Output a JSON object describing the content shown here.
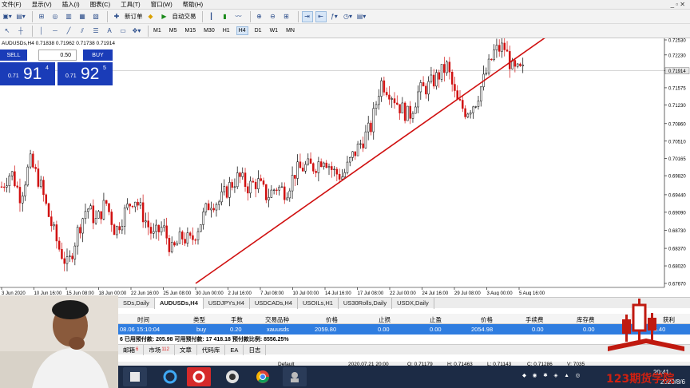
{
  "menu": {
    "items": [
      "文件(F)",
      "显示(V)",
      "插入(I)",
      "图表(C)",
      "工具(T)",
      "窗口(W)",
      "帮助(H)"
    ]
  },
  "toolbar1": {
    "new_order_label": "新订单",
    "autotrade_label": "自动交易"
  },
  "toolbar2": {
    "timeframes": [
      "M1",
      "M5",
      "M15",
      "M30",
      "H1",
      "H4",
      "D1",
      "W1",
      "MN"
    ],
    "selected_timeframe": "H4"
  },
  "chart_header": {
    "symbol": "AUDUSDs,H4",
    "ohlc": "0.71838 0.71962 0.71738 0.71914"
  },
  "trade_panel": {
    "sell_label": "SELL",
    "buy_label": "BUY",
    "lot": "0.50",
    "bid_prefix": "0.71",
    "bid_big": "91",
    "bid_sup": "4",
    "ask_prefix": "0.71",
    "ask_big": "92",
    "ask_sup": "5"
  },
  "chart_data": {
    "type": "candlestick",
    "symbol": "AUDUSDs",
    "timeframe": "H4",
    "y_ticks": [
      "0.72530",
      "0.72230",
      "0.71914",
      "0.71575",
      "0.71230",
      "0.70860",
      "0.70510",
      "0.70165",
      "0.69820",
      "0.69440",
      "0.69090",
      "0.68730",
      "0.68370",
      "0.68020",
      "0.67670"
    ],
    "ylim": [
      0.6767,
      0.7253
    ],
    "current_price": "0.71914",
    "x_ticks": [
      "3 Jun 2020",
      "10 Jun 16:00",
      "15 Jun 08:00",
      "18 Jun 00:00",
      "22 Jun 16:00",
      "25 Jun 08:00",
      "30 Jun 00:00",
      "2 Jul 16:00",
      "7 Jul 08:00",
      "10 Jul 00:00",
      "14 Jul 16:00",
      "17 Jul 08:00",
      "22 Jul 00:00",
      "24 Jul 16:00",
      "29 Jul 08:00",
      "3 Aug 00:00",
      "5 Aug 16:00"
    ],
    "close_series": [
      0.696,
      0.699,
      0.694,
      0.701,
      0.697,
      0.69,
      0.684,
      0.68,
      0.687,
      0.692,
      0.689,
      0.693,
      0.687,
      0.691,
      0.694,
      0.69,
      0.686,
      0.688,
      0.683,
      0.686,
      0.685,
      0.689,
      0.693,
      0.693,
      0.696,
      0.698,
      0.696,
      0.697,
      0.694,
      0.696,
      0.695,
      0.699,
      0.7,
      0.7,
      0.702,
      0.699,
      0.698,
      0.702,
      0.705,
      0.708,
      0.717,
      0.715,
      0.712,
      0.71,
      0.715,
      0.716,
      0.718,
      0.72,
      0.713,
      0.711,
      0.713,
      0.718,
      0.723,
      0.724,
      0.719,
      0.7191
    ],
    "trendline": {
      "color": "#d01010",
      "from": [
        "30 Jun 00:00",
        0.6767
      ],
      "to": [
        "5 Aug 16:00",
        0.7221
      ]
    },
    "candle_up_color": "#000000",
    "candle_down_color": "#d01010"
  },
  "symbol_tabs": {
    "items": [
      "SDs,Daily",
      "AUDUSDs,H4",
      "USDJPYs,H4",
      "USDCADs,H4",
      "USOILs,H1",
      "US30Rolls,Daily",
      "USDX,Daily"
    ],
    "active_index": 1
  },
  "terminal": {
    "headers": [
      "时间",
      "类型",
      "手数",
      "交易品种",
      "价格",
      "止损",
      "止盈",
      "价格",
      "手续费",
      "库存费",
      "获利"
    ],
    "row": [
      "08.06 15:10:04",
      "buy",
      "0.20",
      "xauusds",
      "2059.80",
      "0.00",
      "0.00",
      "2054.98",
      "0.00",
      "0.00",
      "-96.40"
    ],
    "summary": "6  已用预付款: 205.98  可用预付款: 17 418.18  预付款比例: 8556.25%",
    "tabs": [
      {
        "label": "邮箱",
        "count": "6"
      },
      {
        "label": "市场",
        "count": "112"
      },
      {
        "label": "文章",
        "count": ""
      },
      {
        "label": "代码库",
        "count": ""
      },
      {
        "label": "EA",
        "count": ""
      },
      {
        "label": "日志",
        "count": ""
      }
    ]
  },
  "status": {
    "profile": "Default",
    "datetime": "2020.07.21 20:00",
    "open": "O: 0.71179",
    "high": "H: 0.71463",
    "low": "L: 0.71143",
    "close": "C: 0.71286",
    "volume": "V: 7035"
  },
  "taskbar": {
    "time": "20:41",
    "date": "2020/8/6"
  },
  "colors": {
    "panel_blue": "#1a3cb8",
    "row_highlight": "#2f7de0",
    "trendline": "#d01010",
    "taskbar": "#1c2b45"
  }
}
